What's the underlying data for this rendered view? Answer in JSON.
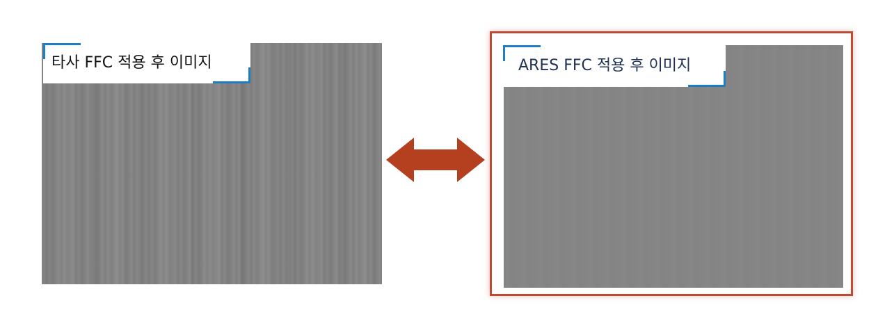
{
  "left_panel": {
    "label": "타사 FFC 적용 후 이미지"
  },
  "right_panel": {
    "label": "ARES FFC 적용 후 이미지",
    "frame_color": "#bd4a32"
  },
  "arrow": {
    "icon": "double-headed-arrow-icon",
    "color": "#b5401f"
  },
  "colors": {
    "image_gray": "#858585",
    "label_corner_accent": "#1c7fc4"
  }
}
